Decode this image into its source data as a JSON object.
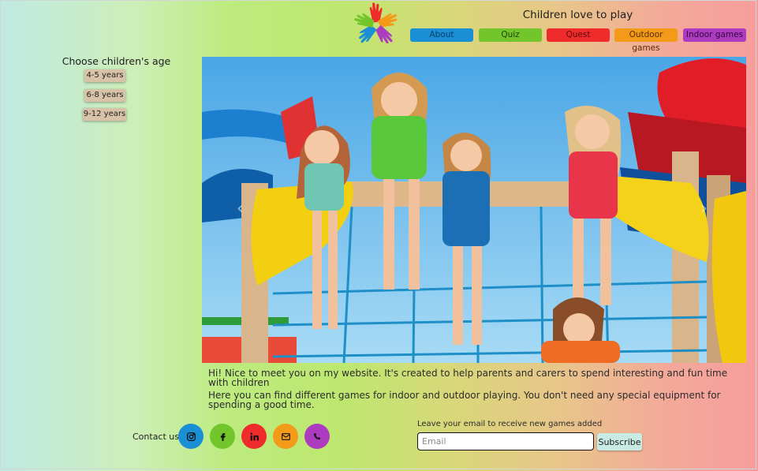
{
  "header": {
    "title": "Children love to play",
    "nav": [
      {
        "label": "About"
      },
      {
        "label": "Quiz"
      },
      {
        "label": "Quest"
      },
      {
        "label": "Outdoor games"
      },
      {
        "label": "Indoor games"
      }
    ]
  },
  "sidebar": {
    "title": "Choose children's age",
    "ages": [
      {
        "label": "4-5 years"
      },
      {
        "label": "6-8 years"
      },
      {
        "label": "9-12 years"
      }
    ]
  },
  "hero": {
    "arrows": {
      "left": "‹",
      "right": "›"
    }
  },
  "intro": {
    "line1": "Hi! Nice to meet you on my website. It's created to help parents and carers to spend interesting and fun time with children",
    "line2": "Here you can find different games for indoor and outdoor playing. You don't need any special equipment for spending a good time."
  },
  "footer": {
    "contact_label": "Contact us",
    "social": [
      {
        "icon": "instagram-icon",
        "color": "#1b8fd6"
      },
      {
        "icon": "facebook-icon",
        "color": "#72c52a"
      },
      {
        "icon": "linkedin-icon",
        "color": "#ef2b2b"
      },
      {
        "icon": "mail-icon",
        "color": "#f39a19"
      },
      {
        "icon": "phone-icon",
        "color": "#ac3bbf"
      }
    ],
    "email_label": "Leave your email to receive new games added",
    "email_placeholder": "Email",
    "subscribe_label": "Subscribe"
  }
}
